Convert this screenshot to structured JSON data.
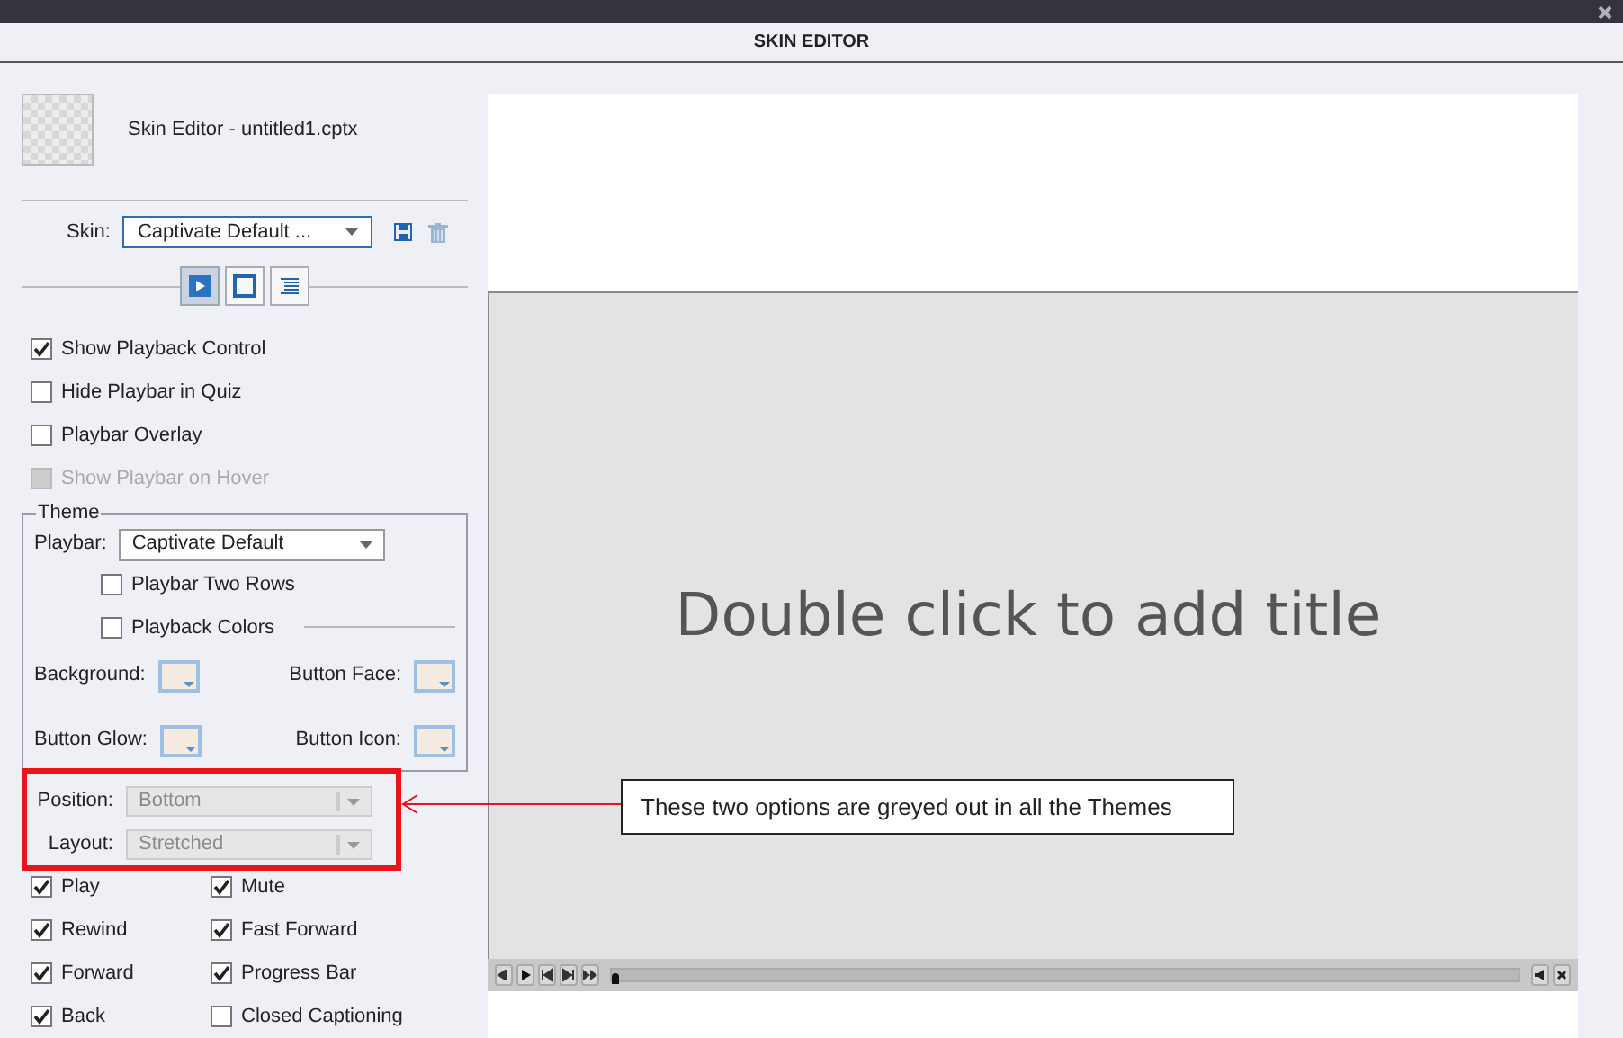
{
  "window": {
    "title": "SKIN EDITOR"
  },
  "header": {
    "title": "Skin Editor - untitled1.cptx"
  },
  "skin": {
    "label": "Skin:",
    "value": "Captivate Default ..."
  },
  "tabs": [
    {
      "kind": "playback",
      "selected": true
    },
    {
      "kind": "borders",
      "selected": false
    },
    {
      "kind": "toc",
      "selected": false
    }
  ],
  "options": [
    {
      "label": "Show Playback Control",
      "checked": true,
      "disabled": false
    },
    {
      "label": "Hide Playbar in Quiz",
      "checked": false,
      "disabled": false
    },
    {
      "label": "Playbar Overlay",
      "checked": false,
      "disabled": false
    },
    {
      "label": "Show Playbar on Hover",
      "checked": false,
      "disabled": true
    }
  ],
  "theme": {
    "legend": "Theme",
    "playbar_label": "Playbar:",
    "playbar_value": "Captivate Default",
    "checkboxes": [
      {
        "label": "Playbar Two Rows",
        "checked": false
      },
      {
        "label": "Playback Colors",
        "checked": false
      }
    ],
    "colors": [
      {
        "label": "Background:"
      },
      {
        "label": "Button Face:"
      },
      {
        "label": "Button Glow:"
      },
      {
        "label": "Button Icon:"
      }
    ]
  },
  "selects": [
    {
      "label": "Position:",
      "value": "Bottom",
      "disabled": true
    },
    {
      "label": "Layout:",
      "value": "Stretched",
      "disabled": true
    }
  ],
  "buttons": [
    {
      "label": "Play",
      "checked": true
    },
    {
      "label": "Mute",
      "checked": true
    },
    {
      "label": "Rewind",
      "checked": true
    },
    {
      "label": "Fast Forward",
      "checked": true
    },
    {
      "label": "Forward",
      "checked": true
    },
    {
      "label": "Progress Bar",
      "checked": true
    },
    {
      "label": "Back",
      "checked": true
    },
    {
      "label": "Closed Captioning",
      "checked": false
    }
  ],
  "preview": {
    "title": "Double click to add title",
    "progress": {
      "level": 0
    }
  },
  "annotation": {
    "text": "These two options are greyed out in all the Themes"
  }
}
